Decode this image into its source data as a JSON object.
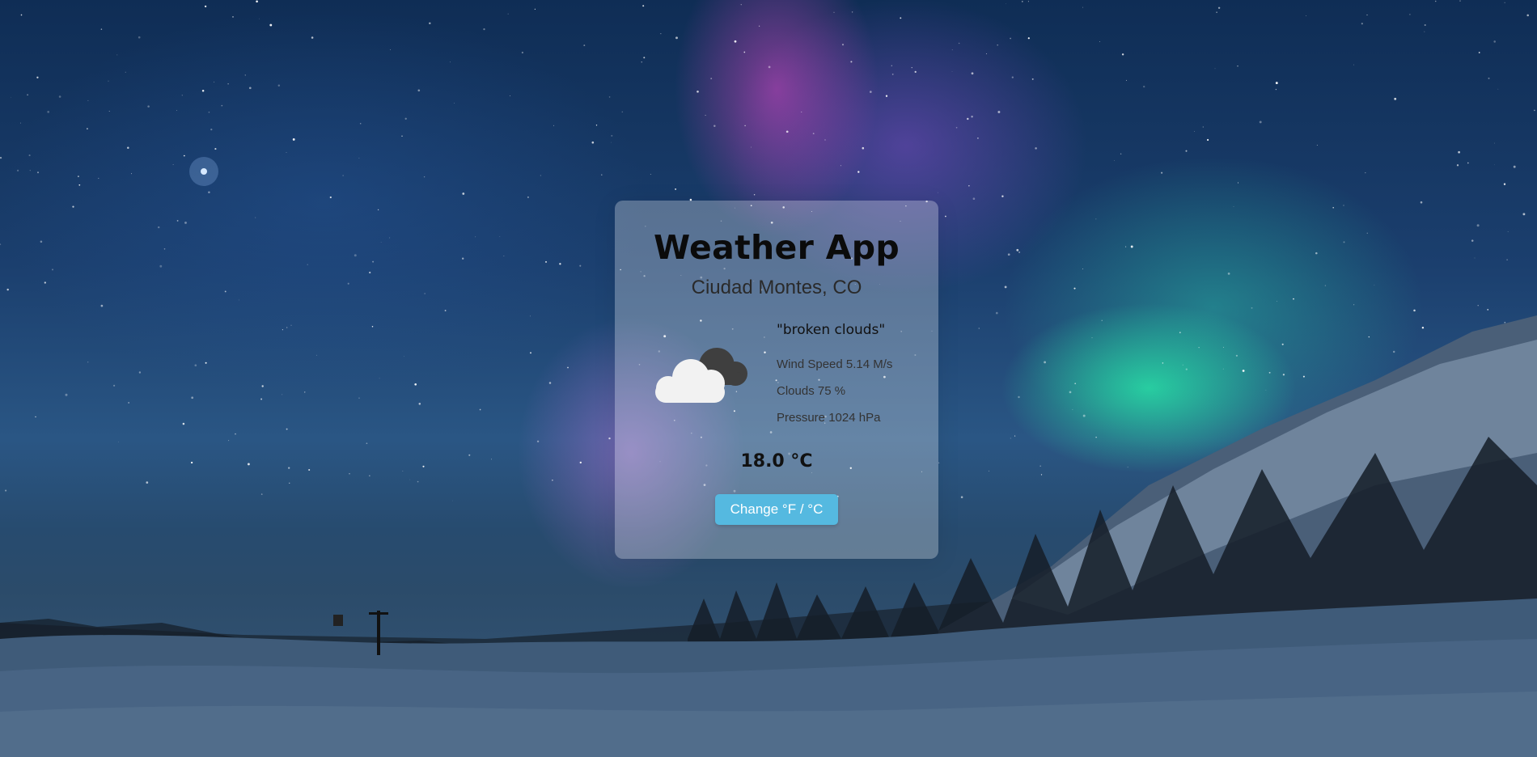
{
  "app": {
    "title": "Weather App",
    "location": "Ciudad Montes, CO"
  },
  "weather": {
    "description": "\"broken clouds\"",
    "icon": "broken-clouds-icon",
    "wind_speed": "Wind Speed 5.14 M/s",
    "clouds": "Clouds 75 %",
    "pressure": "Pressure 1024 hPa",
    "temperature": "18.0 °C"
  },
  "controls": {
    "toggle_units_label": "Change °F / °C"
  },
  "colors": {
    "button": "#55b9e0",
    "card_background": "rgba(255,255,255,0.28)"
  }
}
